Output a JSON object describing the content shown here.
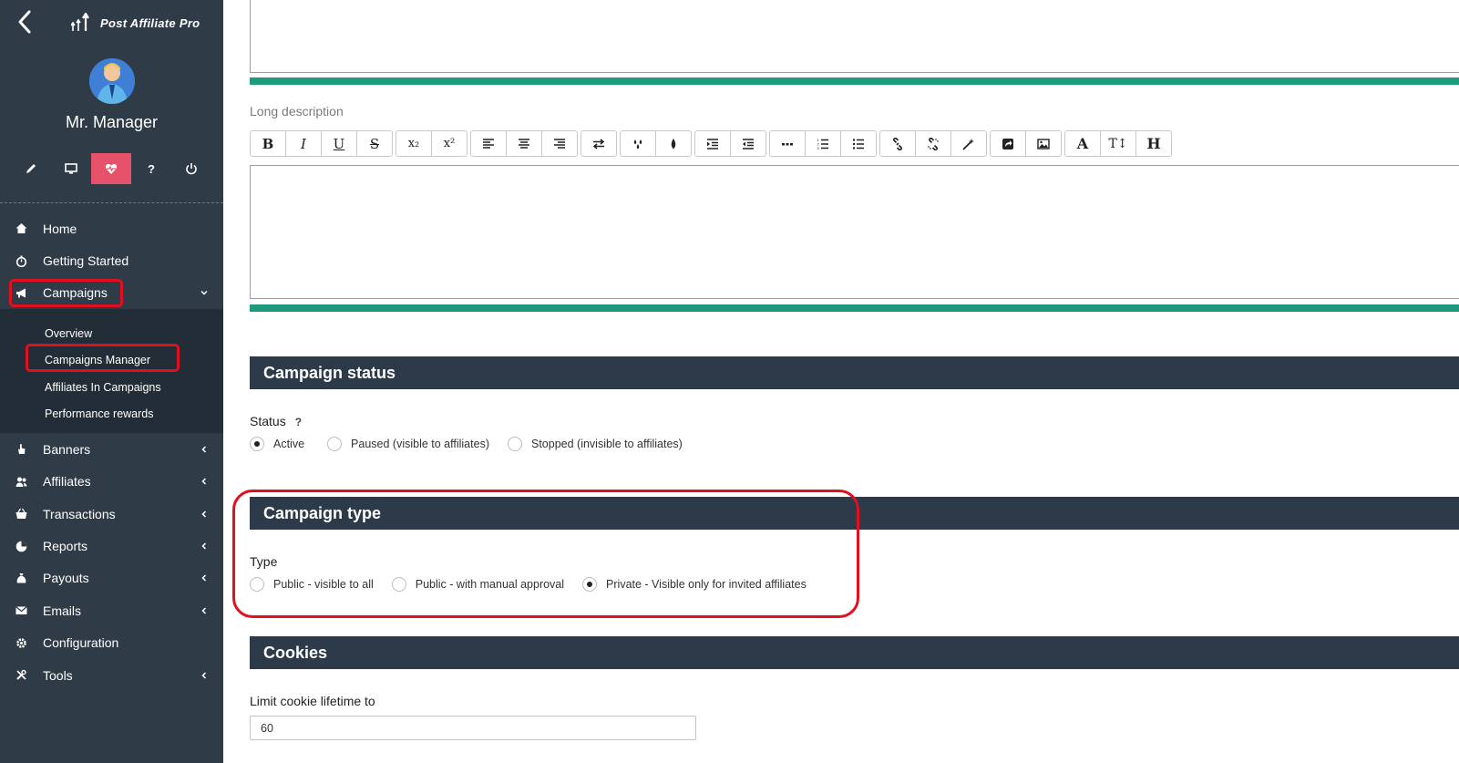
{
  "app": {
    "title": "Post Affiliate Pro"
  },
  "user": {
    "name": "Mr. Manager"
  },
  "toolbar": {
    "buttons": [
      {
        "icon": "pencil-icon"
      },
      {
        "icon": "monitor-icon"
      },
      {
        "icon": "heartbeat-icon",
        "active": true
      },
      {
        "icon": "question-icon"
      },
      {
        "icon": "power-icon"
      }
    ]
  },
  "nav": {
    "home": "Home",
    "getting_started": "Getting Started",
    "campaigns": "Campaigns",
    "campaigns_sub": {
      "overview": "Overview",
      "manager": "Campaigns Manager",
      "affiliates_in": "Affiliates In Campaigns",
      "performance": "Performance rewards"
    },
    "banners": "Banners",
    "affiliates": "Affiliates",
    "transactions": "Transactions",
    "reports": "Reports",
    "payouts": "Payouts",
    "emails": "Emails",
    "configuration": "Configuration",
    "tools": "Tools"
  },
  "editor": {
    "long_description_label": "Long description",
    "toolbar_glyphs": {
      "bold": "B",
      "italic": "I",
      "underline": "U",
      "strike": "S",
      "subscript": "x₂",
      "superscript": "x²",
      "font": "A",
      "font_size": "T↕",
      "heading": "H"
    }
  },
  "status_section": {
    "title": "Campaign status",
    "label": "Status",
    "help": "?",
    "options": [
      {
        "label": "Active",
        "checked": true
      },
      {
        "label": "Paused (visible to affiliates)",
        "checked": false
      },
      {
        "label": "Stopped (invisible to affiliates)",
        "checked": false
      }
    ]
  },
  "type_section": {
    "title": "Campaign type",
    "label": "Type",
    "options": [
      {
        "label": "Public - visible to all",
        "checked": false
      },
      {
        "label": "Public - with manual approval",
        "checked": false
      },
      {
        "label": "Private - Visible only for invited affiliates",
        "checked": true
      }
    ]
  },
  "cookies_section": {
    "title": "Cookies",
    "limit_label": "Limit cookie lifetime to",
    "limit_value": "60"
  },
  "colors": {
    "sidebar": "#2f3b47",
    "sidebar_sub": "#232d37",
    "accent_active": "#e8516a",
    "section_header": "#2c3a4a",
    "editor_bar": "#1f9a7c",
    "highlight": "#e0101e"
  }
}
